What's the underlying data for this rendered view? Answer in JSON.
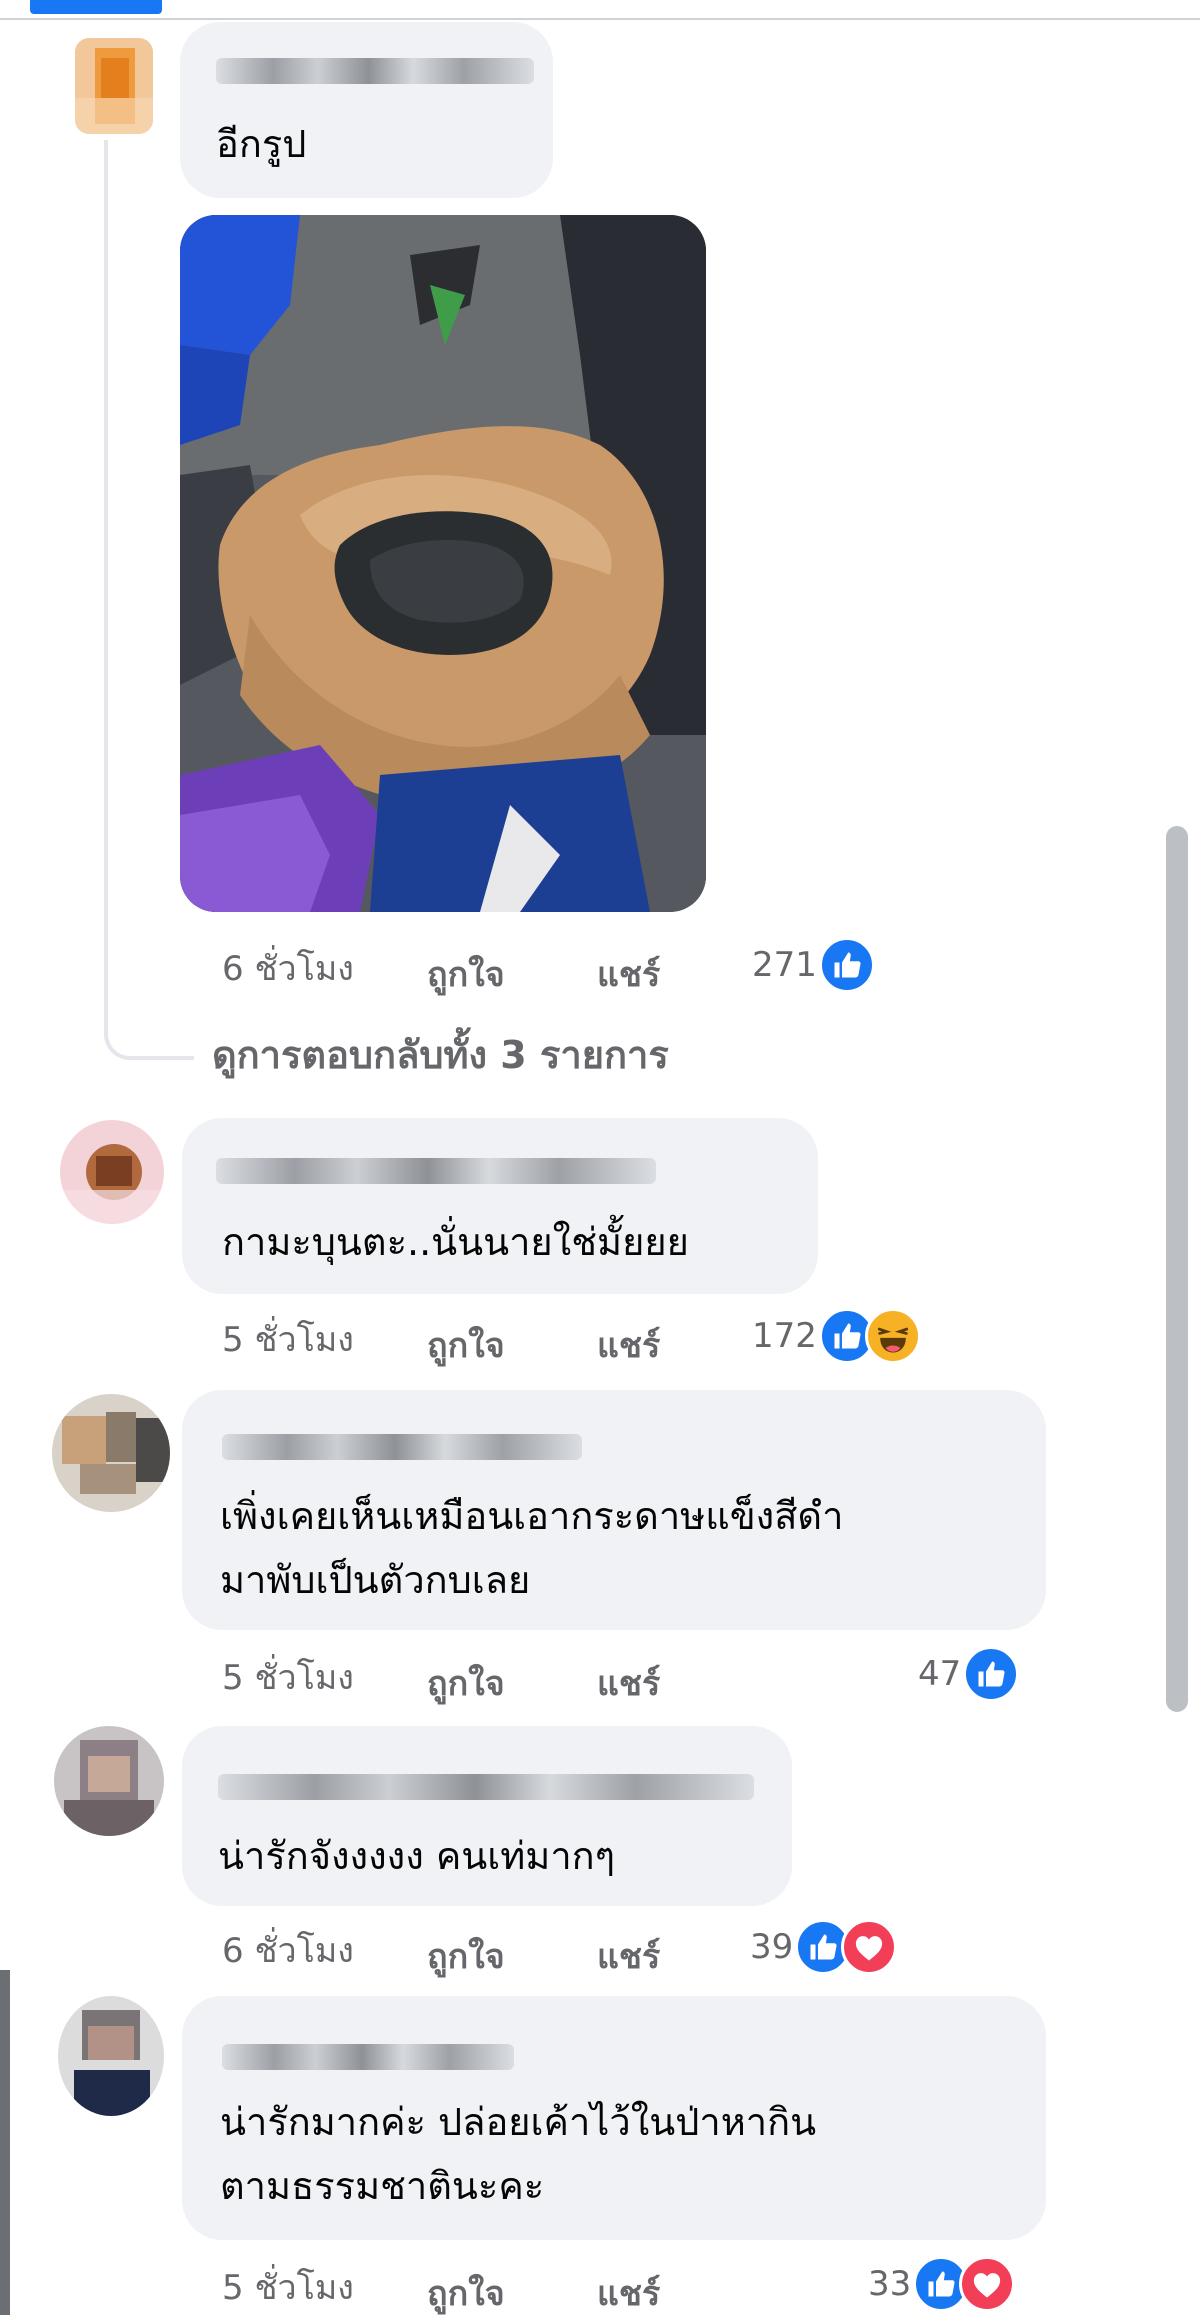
{
  "comments": [
    {
      "author": "",
      "text_lines": [
        "อีกรูป"
      ],
      "time": "6 ชั่วโมง",
      "like_label": "ถูกใจ",
      "share_label": "แชร์",
      "reaction_count": "271",
      "reactions": [
        "like-icon"
      ],
      "has_photo": true
    },
    {
      "author": "",
      "text_lines": [
        "กามะบุนตะ..นั่นนายใช่มั้ยยย"
      ],
      "time": "5 ชั่วโมง",
      "like_label": "ถูกใจ",
      "share_label": "แชร์",
      "reaction_count": "172",
      "reactions": [
        "like-icon",
        "haha-icon"
      ]
    },
    {
      "author": "",
      "text_lines": [
        "เพิ่งเคยเห็นเหมือนเอากระดาษแข็งสีดำ",
        "มาพับเป็นตัวกบเลย"
      ],
      "time": "5 ชั่วโมง",
      "like_label": "ถูกใจ",
      "share_label": "แชร์",
      "reaction_count": "47",
      "reactions": [
        "like-icon"
      ]
    },
    {
      "author": "",
      "text_lines": [
        "น่ารักจังงงงง คนเท่มากๆ"
      ],
      "time": "6 ชั่วโมง",
      "like_label": "ถูกใจ",
      "share_label": "แชร์",
      "reaction_count": "39",
      "reactions": [
        "like-icon",
        "love-icon"
      ]
    },
    {
      "author": "",
      "text_lines": [
        "น่ารักมากค่ะ ปล่อยเค้าไว้ในป่าหากิน",
        "ตามธรรมชาตินะคะ"
      ],
      "time": "5 ชั่วโมง",
      "like_label": "ถูกใจ",
      "share_label": "แชร์",
      "reaction_count": "33",
      "reactions": [
        "like-icon",
        "love-icon"
      ]
    }
  ],
  "view_replies_label": "ดูการตอบกลับทั้ง 3 รายการ",
  "colors": {
    "bubble": "#f0f2f5",
    "meta_text": "#65676b",
    "like_blue": "#1877f2",
    "love_red": "#f33e58",
    "haha_yellow": "#f7b125",
    "scrollbar": "#bcc0c4"
  }
}
